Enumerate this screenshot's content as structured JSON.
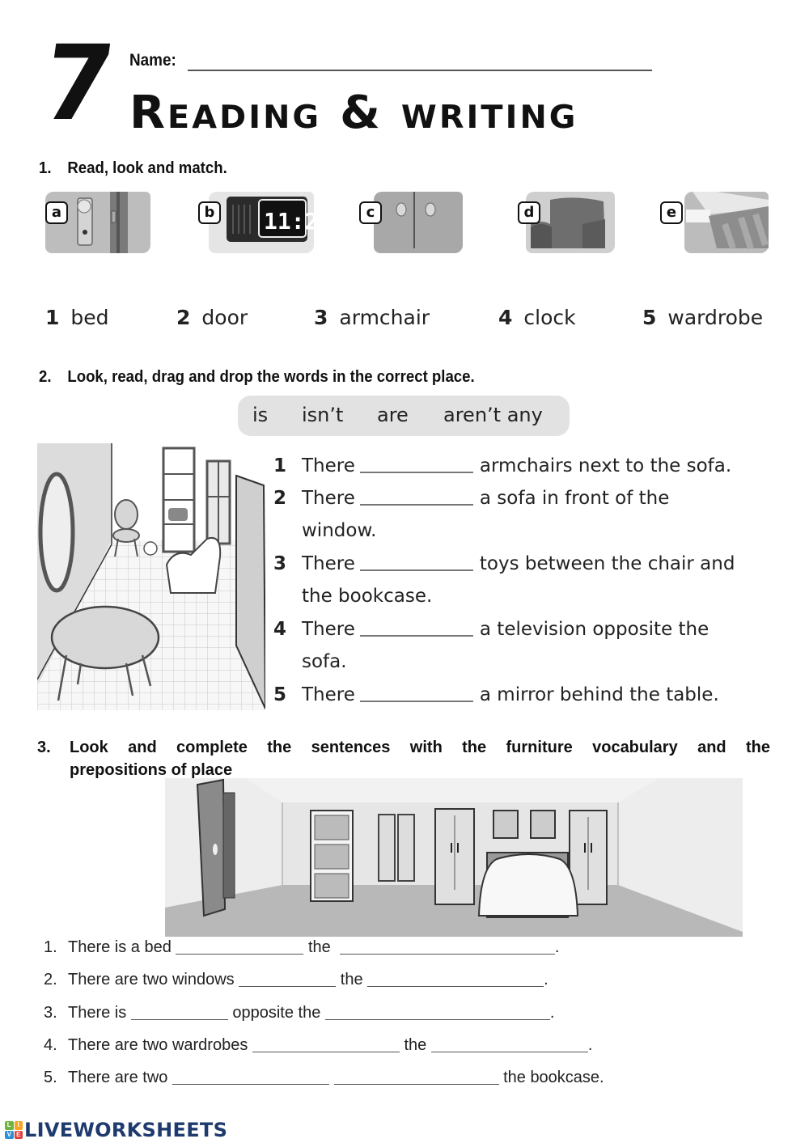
{
  "header": {
    "unit_number": "7",
    "name_label": "Name:",
    "title": "Reading & writing"
  },
  "section1": {
    "number": "1.",
    "instruction": "Read, look and match.",
    "pictures": [
      {
        "label": "a",
        "depicts": "door-handle"
      },
      {
        "label": "b",
        "depicts": "digital-clock"
      },
      {
        "label": "c",
        "depicts": "wardrobe-doors"
      },
      {
        "label": "d",
        "depicts": "armchair"
      },
      {
        "label": "e",
        "depicts": "bed"
      }
    ],
    "words": [
      {
        "number": "1",
        "word": "bed"
      },
      {
        "number": "2",
        "word": "door"
      },
      {
        "number": "3",
        "word": "armchair"
      },
      {
        "number": "4",
        "word": "clock"
      },
      {
        "number": "5",
        "word": "wardrobe"
      }
    ]
  },
  "section2": {
    "number": "2.",
    "instruction": "Look, read, drag and drop the words in the correct place.",
    "word_bank": [
      "is",
      "isn’t",
      "are",
      "aren’t any"
    ],
    "sentences": [
      {
        "number": "1",
        "start": "There",
        "end": "armchairs next to the sofa.",
        "continuation": ""
      },
      {
        "number": "2",
        "start": "There",
        "end": "a sofa in front of the",
        "continuation": "window."
      },
      {
        "number": "3",
        "start": "There",
        "end": "toys between the chair and",
        "continuation": "the bookcase."
      },
      {
        "number": "4",
        "start": "There",
        "end": "a television opposite the",
        "continuation": "sofa."
      },
      {
        "number": "5",
        "start": "There",
        "end": "a mirror behind the table.",
        "continuation": ""
      }
    ]
  },
  "section3": {
    "number": "3.",
    "instruction_line1": "Look and complete the sentences with the furniture vocabulary and the",
    "instruction_line2": "prepositions of place",
    "sentences": [
      {
        "number": "1.",
        "parts": [
          "There is a bed",
          "the",
          "."
        ]
      },
      {
        "number": "2.",
        "parts": [
          "There are two windows",
          "the",
          "."
        ]
      },
      {
        "number": "3.",
        "parts": [
          "There is",
          "opposite the",
          "."
        ]
      },
      {
        "number": "4.",
        "parts": [
          "There are two wardrobes",
          "the",
          "."
        ]
      },
      {
        "number": "5.",
        "parts": [
          "There are two",
          "",
          "the bookcase."
        ]
      }
    ]
  },
  "footer": {
    "brand": "LIVEWORKSHEETS",
    "logo_letters": [
      "L",
      "I",
      "V",
      "E"
    ],
    "logo_colors": [
      "#6cb33f",
      "#f5a623",
      "#2d8fd5",
      "#e2413b"
    ]
  }
}
